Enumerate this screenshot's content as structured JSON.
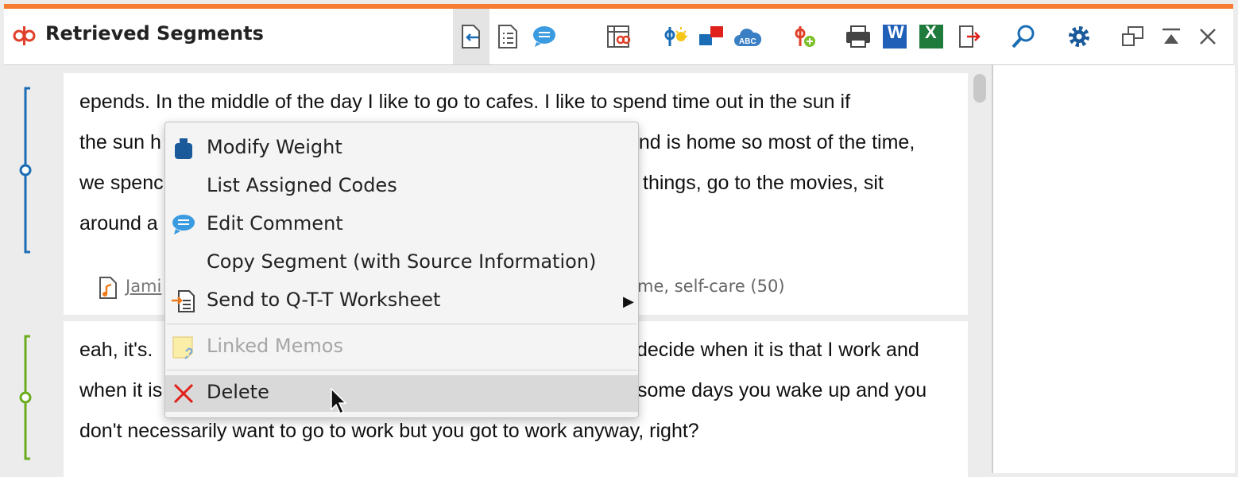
{
  "window": {
    "title": "Retrieved Segments",
    "accent": "#f47b30"
  },
  "toolbar": {
    "buttons": [
      {
        "name": "show-document-icon"
      },
      {
        "name": "list-icon"
      },
      {
        "name": "comment-icon"
      },
      {
        "name": "code-matrix-icon"
      },
      {
        "name": "code-idea-icon"
      },
      {
        "name": "color-codes-icon"
      },
      {
        "name": "word-cloud-icon"
      },
      {
        "name": "add-code-icon"
      },
      {
        "name": "print-icon"
      },
      {
        "name": "word-export-icon",
        "label": "W"
      },
      {
        "name": "excel-export-icon",
        "label": "X"
      },
      {
        "name": "export-icon"
      },
      {
        "name": "search-icon"
      },
      {
        "name": "settings-icon"
      },
      {
        "name": "undock-icon"
      },
      {
        "name": "collapse-icon"
      },
      {
        "name": "close-icon"
      }
    ]
  },
  "segments": [
    {
      "lines": [
        "epends. In the middle of the day I like to go to cafes. I like to spend time out in the sun if",
        "the sun h",
        "end is home so most of the time,",
        "we spenc",
        "things, go to the movies, sit",
        "around a"
      ],
      "source_link": "Jami",
      "codes": "me, self-care (50)",
      "color": "#1a6db5"
    },
    {
      "lines": [
        "eah, it's.",
        "decide when it is that I work and",
        "when it is",
        "some days you wake up and you",
        "don't necessarily want to go to work but you got to work anyway, right?"
      ],
      "color": "#6aad1e"
    }
  ],
  "context_menu": {
    "items": [
      {
        "label": "Modify Weight",
        "icon": "weight-icon"
      },
      {
        "label": "List Assigned Codes"
      },
      {
        "label": "Edit Comment",
        "icon": "comment-icon"
      },
      {
        "label": "Copy Segment (with Source Information)"
      },
      {
        "label": "Send to Q-T-T Worksheet",
        "icon": "worksheet-icon",
        "submenu": "▶"
      },
      {
        "label": "Linked Memos",
        "icon": "memo-link-icon",
        "disabled": true
      },
      {
        "label": "Delete",
        "icon": "delete-icon"
      }
    ]
  }
}
